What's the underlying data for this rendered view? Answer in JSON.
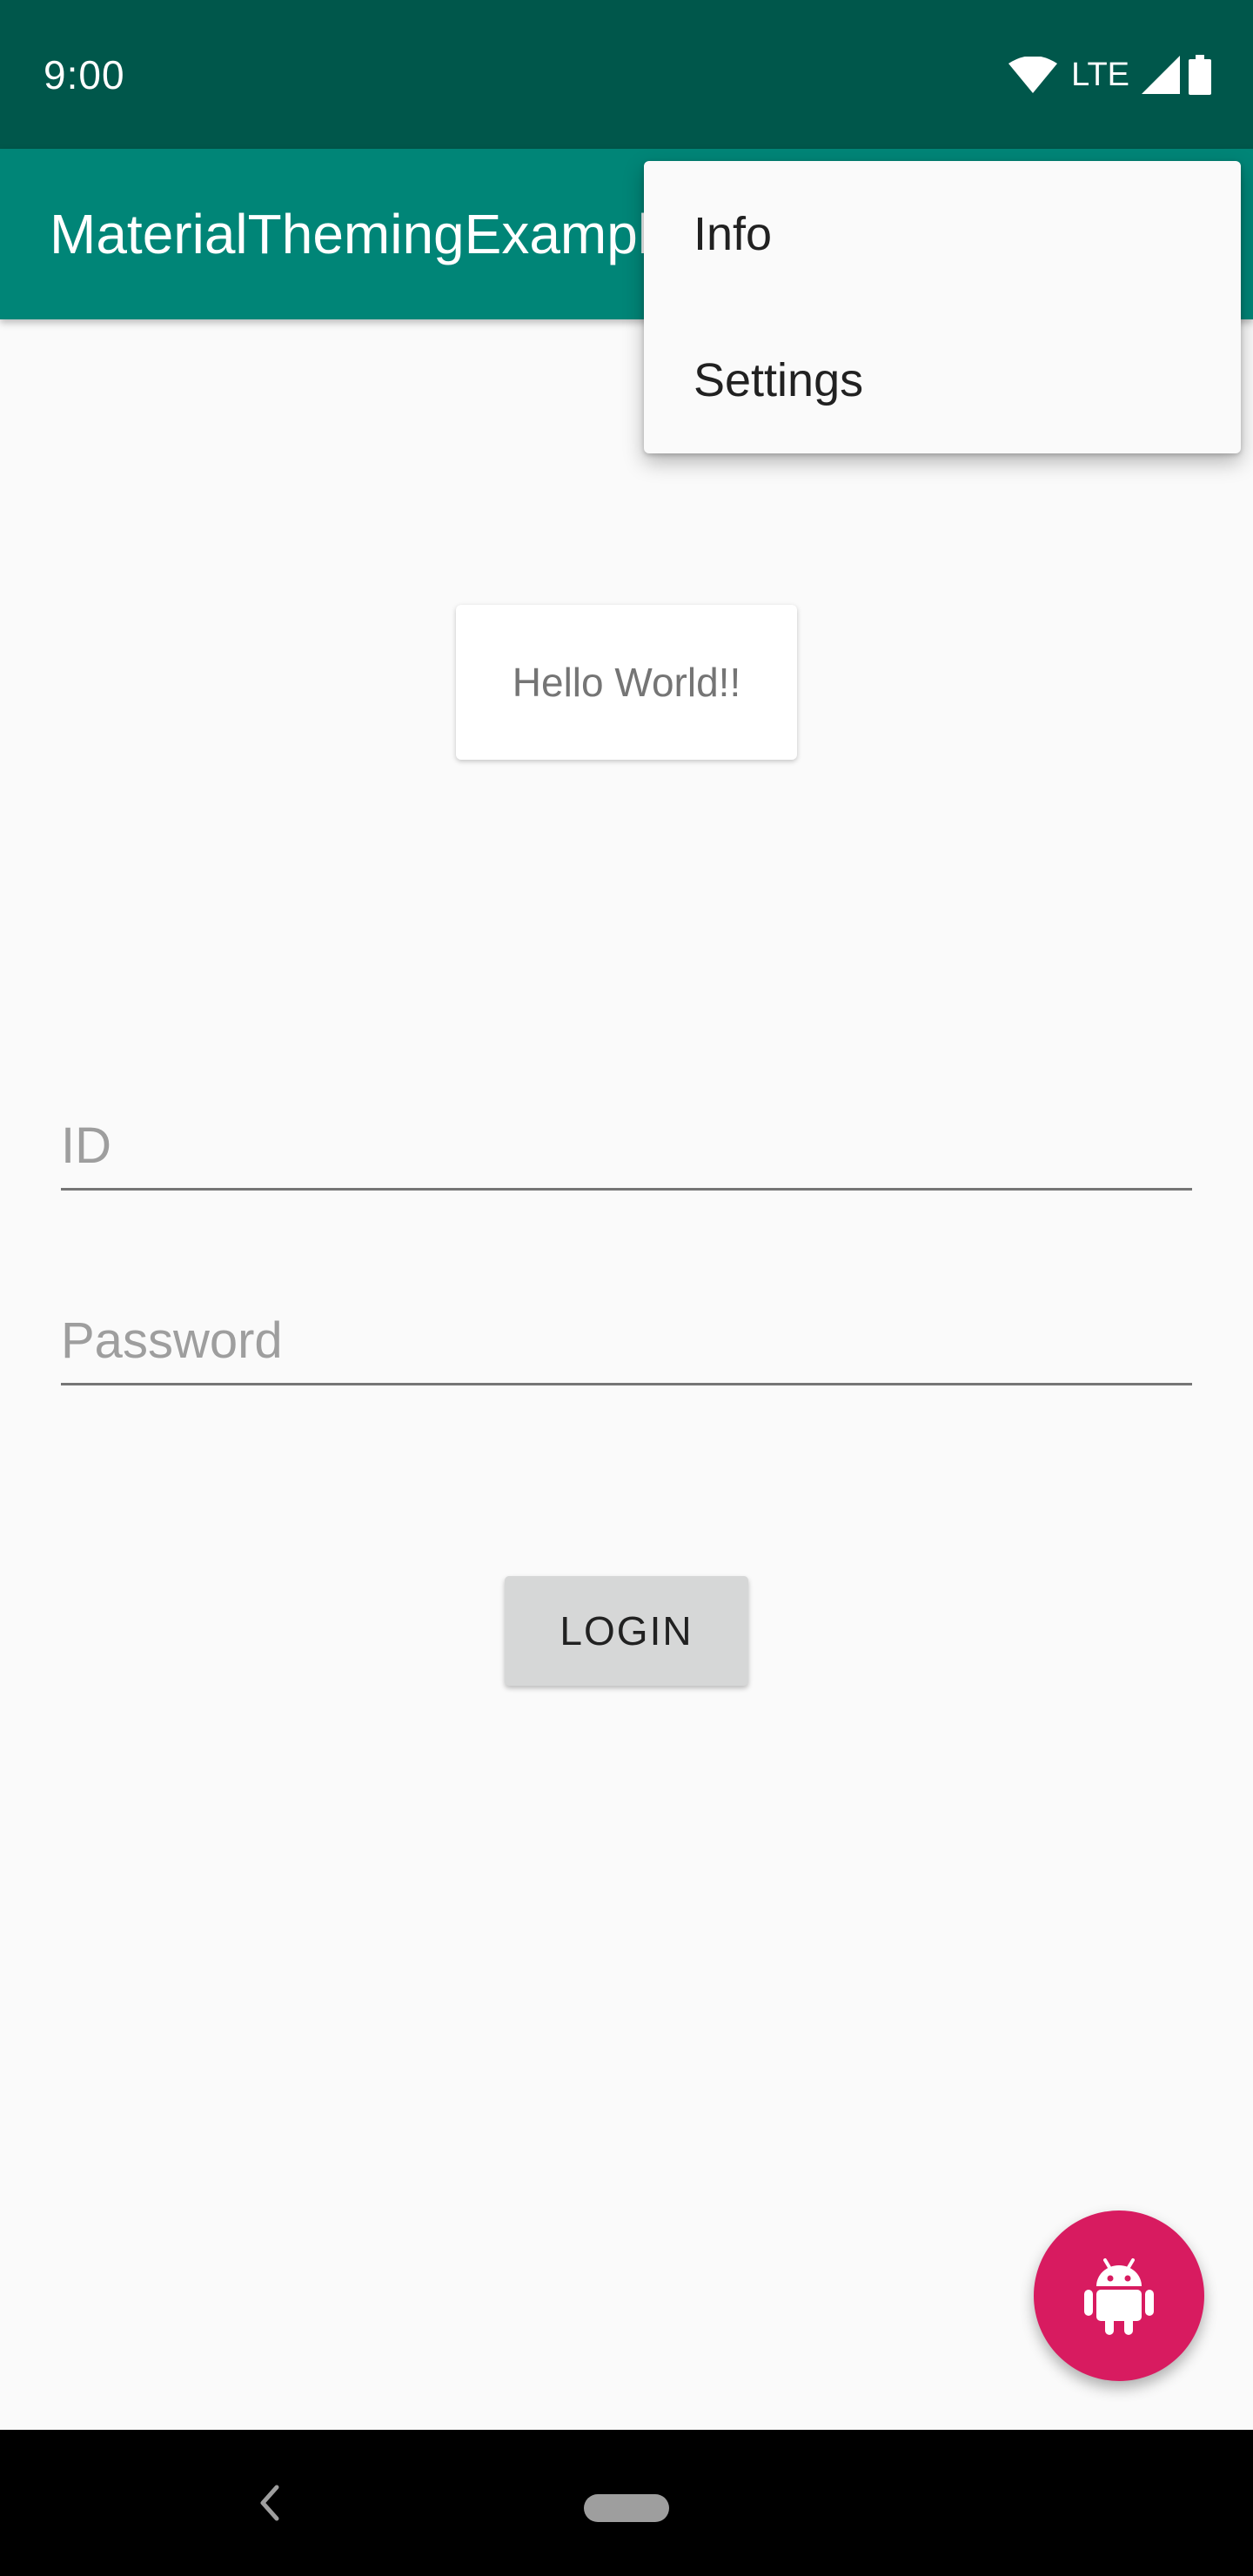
{
  "status_bar": {
    "time": "9:00",
    "network_label": "LTE",
    "icons": [
      "wifi-icon",
      "cell-signal-icon",
      "battery-icon"
    ]
  },
  "app_bar": {
    "title": "MaterialThemingExample"
  },
  "overflow_menu": {
    "items": [
      {
        "label": "Info"
      },
      {
        "label": "Settings"
      }
    ]
  },
  "content": {
    "card_text": "Hello World!!",
    "id_field": {
      "placeholder": "ID",
      "value": ""
    },
    "password_field": {
      "placeholder": "Password",
      "value": ""
    },
    "login_label": "LOGIN"
  },
  "fab": {
    "icon": "android-icon"
  },
  "colors": {
    "status_bar": "#00574b",
    "primary": "#008577",
    "accent": "#d81b60",
    "background": "#fafafa"
  }
}
